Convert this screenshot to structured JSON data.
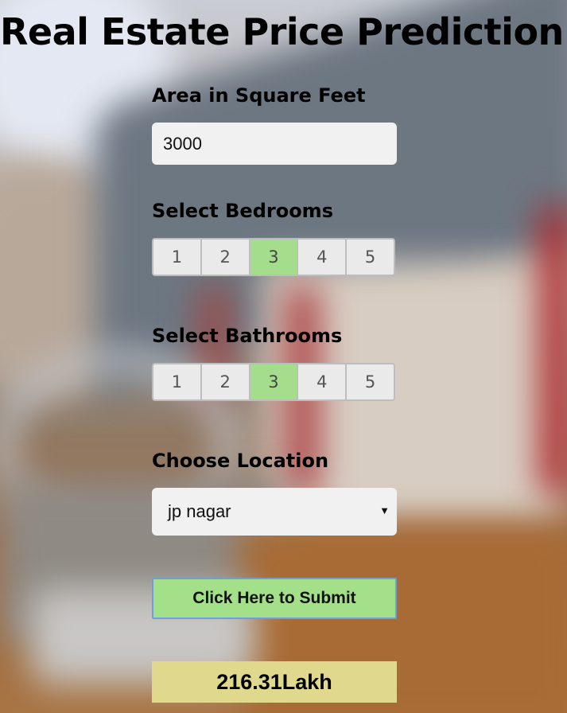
{
  "title": "Real Estate Price Prediction",
  "area": {
    "label": "Area in Square Feet",
    "value": "3000"
  },
  "bedrooms": {
    "label": "Select Bedrooms",
    "options": [
      "1",
      "2",
      "3",
      "4",
      "5"
    ],
    "selected": "3"
  },
  "bathrooms": {
    "label": "Select Bathrooms",
    "options": [
      "1",
      "2",
      "3",
      "4",
      "5"
    ],
    "selected": "3"
  },
  "location": {
    "label": "Choose Location",
    "selected": "jp nagar",
    "arrow_glyph": "▼"
  },
  "submit": {
    "label": "Click Here to Submit"
  },
  "result": {
    "value": "216.31Lakh"
  },
  "colors": {
    "selected_option": "#a4dd8c",
    "submit_button": "#a4df89",
    "result_box": "#e0d88c",
    "input_background": "#f1f1f1"
  },
  "icons": {
    "select_arrow": "dropdown-arrow-icon"
  }
}
